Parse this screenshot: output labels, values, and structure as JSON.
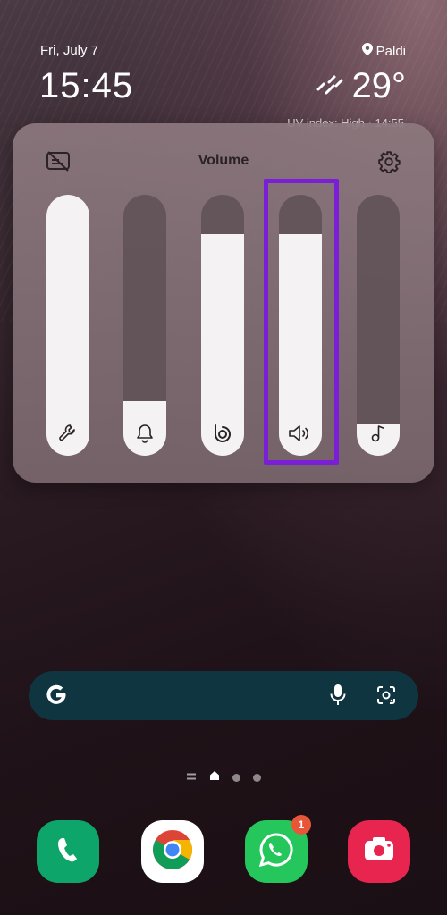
{
  "status": {
    "date": "Fri, July 7",
    "location": "Paldi",
    "time": "15:45",
    "temperature": "29°",
    "uv_text": "UV index: High · 14:55"
  },
  "volume_panel": {
    "title": "Volume",
    "sliders": [
      {
        "name": "system",
        "icon": "wrench-icon",
        "level": 1.0
      },
      {
        "name": "ringtone",
        "icon": "bell-icon",
        "level": 0.21
      },
      {
        "name": "bixby",
        "icon": "bixby-icon",
        "level": 0.85
      },
      {
        "name": "media",
        "icon": "speaker-icon",
        "level": 0.85,
        "highlighted": true
      },
      {
        "name": "notifications",
        "icon": "music-note-icon",
        "level": 0.12
      }
    ],
    "highlight_color": "#7a1fd6"
  },
  "search_bar": {
    "logo": "G",
    "icons": [
      "mic-icon",
      "lens-icon"
    ]
  },
  "page_indicator": {
    "pages": 3,
    "current": "home"
  },
  "dock": [
    {
      "name": "phone",
      "icon": "phone-icon",
      "color": "#0ea56a"
    },
    {
      "name": "chrome",
      "icon": "chrome-icon",
      "color": "#ffffff"
    },
    {
      "name": "whatsapp",
      "icon": "whatsapp-icon",
      "color": "#25c75c",
      "badge": "1"
    },
    {
      "name": "camera",
      "icon": "camera-icon",
      "color": "#e8254e"
    }
  ]
}
